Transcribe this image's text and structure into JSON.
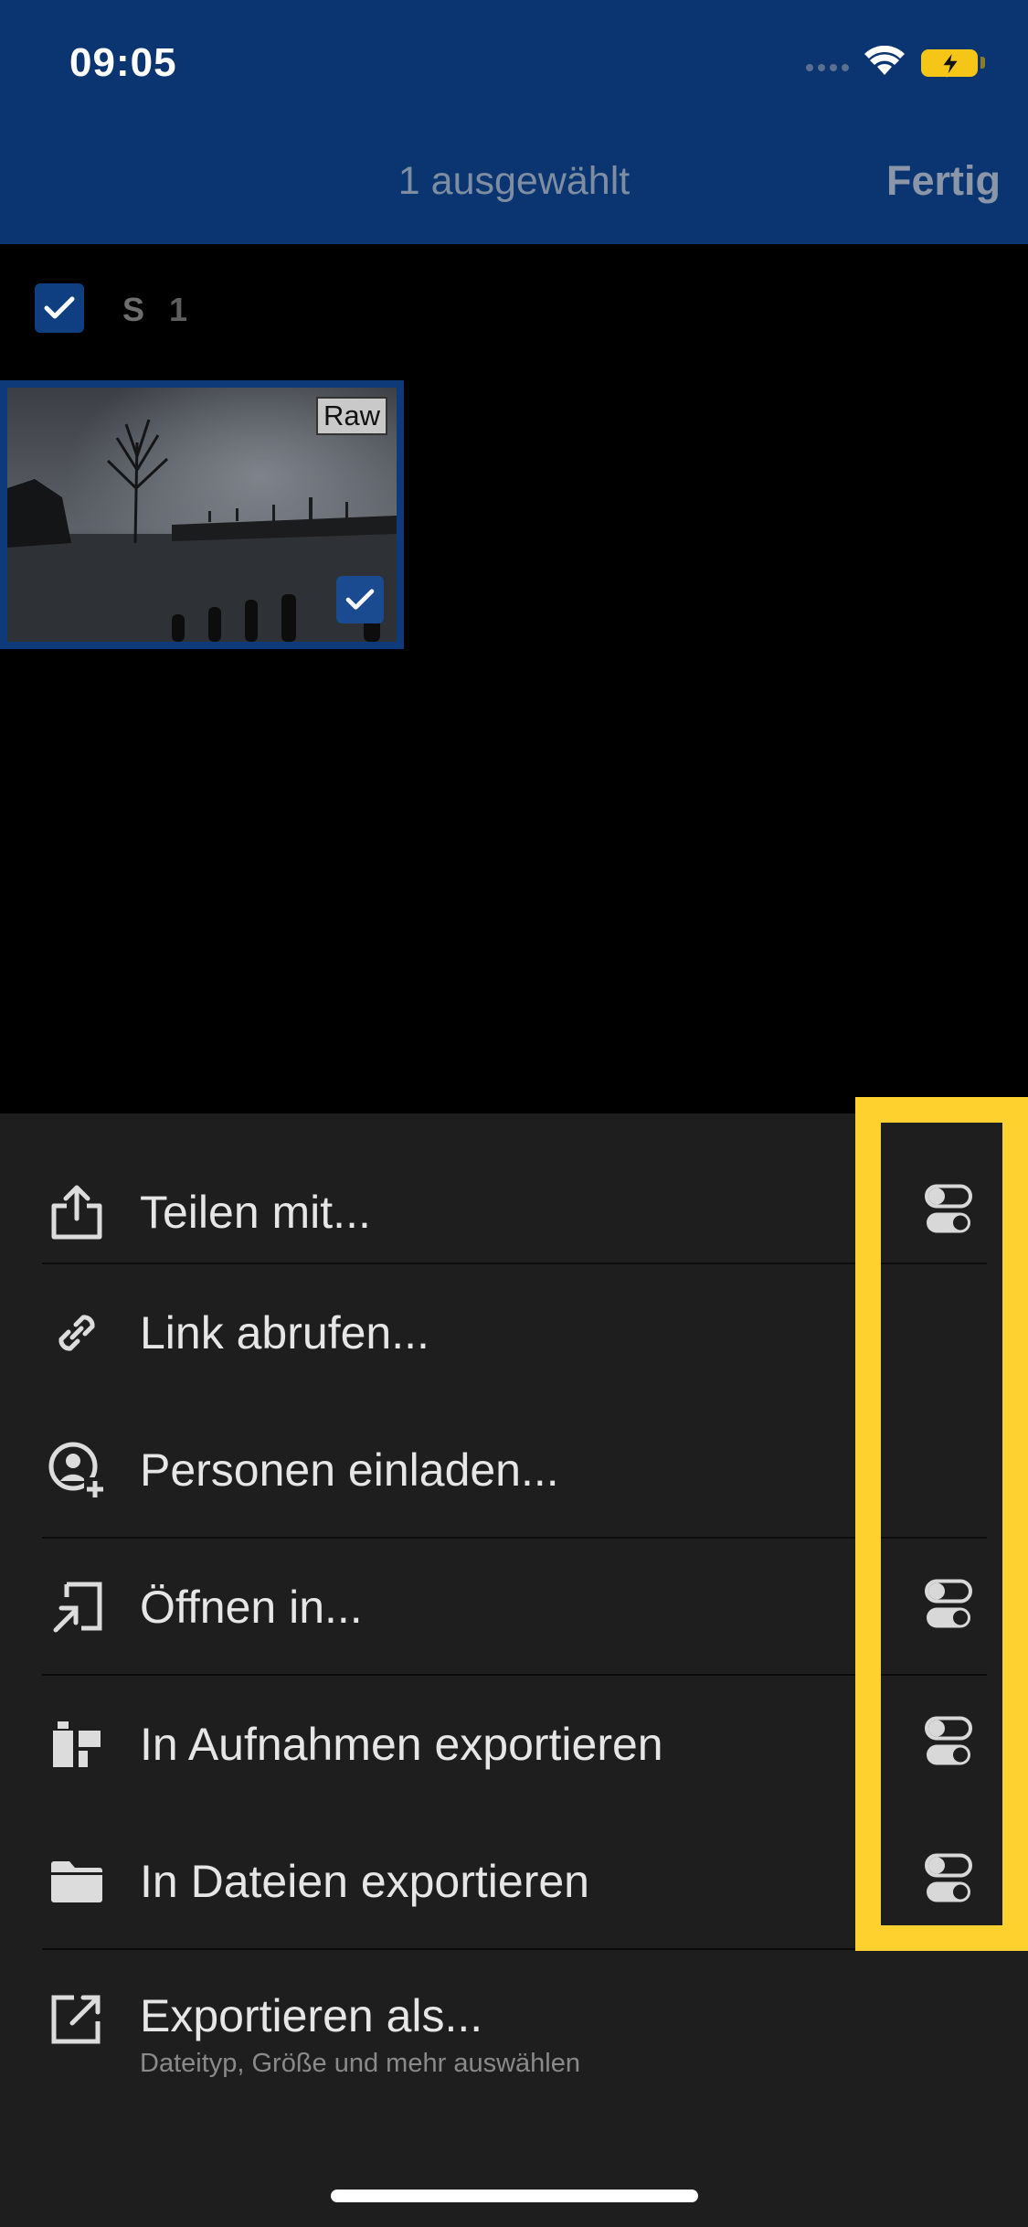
{
  "status_bar": {
    "time": "09:05",
    "icons": [
      "signal-icon",
      "wifi-icon",
      "battery-charging-icon"
    ],
    "battery_color": "#f5c518"
  },
  "header": {
    "title": "1 ausgewählt",
    "done_label": "Fertig",
    "background": "#0a3570"
  },
  "group": {
    "label": "S",
    "count": "1",
    "checked": true
  },
  "thumbnail": {
    "badge": "Raw",
    "selected": true
  },
  "menu": {
    "items": [
      {
        "label": "Teilen mit...",
        "icon": "share-icon",
        "has_options": true
      },
      {
        "label": "Link abrufen...",
        "icon": "link-icon",
        "has_options": false
      },
      {
        "label": "Personen einladen...",
        "icon": "invite-person-icon",
        "has_options": false
      },
      {
        "label": "Öffnen in...",
        "icon": "open-in-icon",
        "has_options": true
      },
      {
        "label": "In Aufnahmen exportieren",
        "icon": "camera-roll-export-icon",
        "has_options": true
      },
      {
        "label": "In Dateien exportieren",
        "icon": "folder-icon",
        "has_options": true
      },
      {
        "label": "Exportieren als...",
        "sublabel": "Dateityp, Größe und mehr auswählen",
        "icon": "export-as-icon",
        "has_options": false
      }
    ]
  },
  "colors": {
    "sheet_background": "#1e1e1e",
    "highlight": "#ffd12e",
    "accent_blue": "#0e3a7a"
  }
}
